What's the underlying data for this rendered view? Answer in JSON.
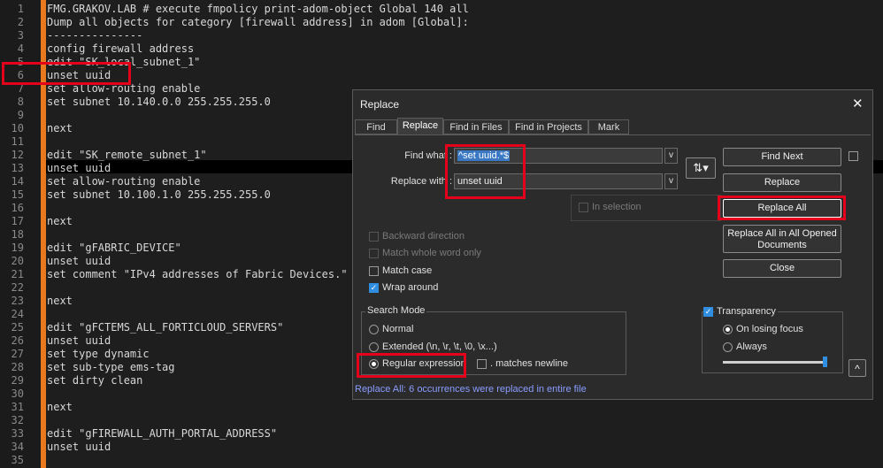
{
  "editor": {
    "lines": [
      "FMG.GRAKOV.LAB # execute fmpolicy print-adom-object Global 140 all",
      "Dump all objects for category [firewall address] in adom [Global]:",
      "---------------",
      "config firewall address",
      "edit \"SK_local_subnet_1\"",
      "unset uuid",
      "set allow-routing enable",
      "set subnet 10.140.0.0 255.255.255.0",
      "",
      "next",
      "",
      "edit \"SK_remote_subnet_1\"",
      "unset uuid",
      "set allow-routing enable",
      "set subnet 10.100.1.0 255.255.255.0",
      "",
      "next",
      "",
      "edit \"gFABRIC_DEVICE\"",
      "unset uuid",
      "set comment \"IPv4 addresses of Fabric Devices.\"",
      "",
      "next",
      "",
      "edit \"gFCTEMS_ALL_FORTICLOUD_SERVERS\"",
      "unset uuid",
      "set type dynamic",
      "set sub-type ems-tag",
      "set dirty clean",
      "",
      "next",
      "",
      "edit \"gFIREWALL_AUTH_PORTAL_ADDRESS\"",
      "unset uuid",
      ""
    ],
    "line_numbers": [
      "1",
      "2",
      "3",
      "4",
      "5",
      "6",
      "7",
      "8",
      "9",
      "10",
      "11",
      "12",
      "13",
      "14",
      "15",
      "16",
      "17",
      "18",
      "19",
      "20",
      "21",
      "22",
      "23",
      "24",
      "25",
      "26",
      "27",
      "28",
      "29",
      "30",
      "31",
      "32",
      "33",
      "34",
      "35"
    ]
  },
  "dialog": {
    "title": "Replace",
    "close_glyph": "✕",
    "tabs": [
      "Find",
      "Replace",
      "Find in Files",
      "Find in Projects",
      "Mark"
    ],
    "find_label": "Find what :",
    "find_value": "^set uuid.*$",
    "replace_label": "Replace with :",
    "replace_value": "unset uuid",
    "dropdown_glyph": "v",
    "swap_glyph": "⇅",
    "in_selection": "In selection",
    "buttons": {
      "find_next": "Find Next",
      "replace": "Replace",
      "replace_all": "Replace All",
      "replace_all_opened_1": "Replace All in All Opened",
      "replace_all_opened_2": "Documents",
      "close": "Close"
    },
    "options": {
      "backward": "Backward direction",
      "whole_word": "Match whole word only",
      "match_case": "Match case",
      "wrap_around": "Wrap around"
    },
    "search_mode": {
      "title": "Search Mode",
      "normal": "Normal",
      "extended": "Extended (\\n, \\r, \\t, \\0, \\x...)",
      "regex": "Regular expression",
      "matches_newline": ". matches newline"
    },
    "transparency": {
      "title": "Transparency",
      "on_losing_focus": "On losing focus",
      "always": "Always"
    },
    "collapse_glyph": "^",
    "status": "Replace All: 6 occurrences were replaced in entire file"
  },
  "colors": {
    "accent_red": "#e3001b",
    "fold_bar": "#e8791e",
    "status_text": "#8a9cff"
  }
}
